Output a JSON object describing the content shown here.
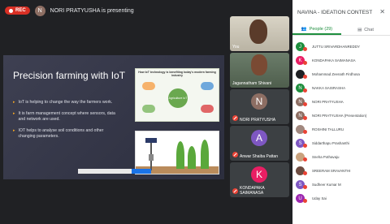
{
  "topbar": {
    "rec_label": "REC",
    "presenter_initial": "N",
    "presenter_text": "NORI PRATYUSHA is presenting"
  },
  "slide": {
    "title": "Precision farming with IoT",
    "bullets": [
      "IoT is helping to change the way the farmers work.",
      "It is farm management concept where sensors, data and network are used.",
      "IOT helps to analyse soil conditions and other changing parameters."
    ],
    "img1_header": "How IoT technology is benefiting today's modern farming industry",
    "img1_hub": "Agriculture IoT"
  },
  "tiles": {
    "you": {
      "name": "You"
    },
    "jagannatham": {
      "name": "Jagannatham Shivani"
    },
    "nori": {
      "initial": "N",
      "name": "NORI PRATYUSHA"
    },
    "anwar": {
      "initial": "A",
      "name": "Anwar Shaiba Pattan"
    },
    "kondapaka": {
      "initial": "K",
      "name": "KONDAPAKA SAIMANASA"
    }
  },
  "panel": {
    "title": "NAVINA - IDEATION CONTEST",
    "close_icon": "close-icon",
    "tabs": [
      {
        "label": "People (29)",
        "icon": "people-icon",
        "active": true
      },
      {
        "label": "Chat",
        "icon": "chat-icon",
        "active": false
      }
    ],
    "people": [
      {
        "initial": "J",
        "color": "#1e8e3e",
        "name": "JUTTU SRIVARDHANREDDY"
      },
      {
        "initial": "K",
        "color": "#e91e63",
        "name": "KONDAPAKA SAIMANASA"
      },
      {
        "initial": "",
        "color": "#202124",
        "name": "Mohammad Zeenath Firdhosa"
      },
      {
        "initial": "N",
        "color": "#1e8e3e",
        "name": "NAKKA SAISRASHA"
      },
      {
        "initial": "N",
        "color": "#8d6e63",
        "name": "NORI PRATYUSHA"
      },
      {
        "initial": "N",
        "color": "#8d6e63",
        "name": "NORI PRATYUSHA (Presentation)"
      },
      {
        "initial": "",
        "color": "#a1887f",
        "name": "ROSHINI TALLURU"
      },
      {
        "initial": "S",
        "color": "#7e57c2",
        "name": "Siddarthapu Prashanthi"
      },
      {
        "initial": "",
        "color": "#c9a27e",
        "name": "Sneha Pothavaju"
      },
      {
        "initial": "",
        "color": "#6d4c41",
        "name": "SREERAM SRAVANTHI"
      },
      {
        "initial": "S",
        "color": "#7e57c2",
        "name": "Sudheer Kumar M"
      },
      {
        "initial": "U",
        "color": "#9c27b0",
        "name": "Uday Sai"
      }
    ]
  }
}
